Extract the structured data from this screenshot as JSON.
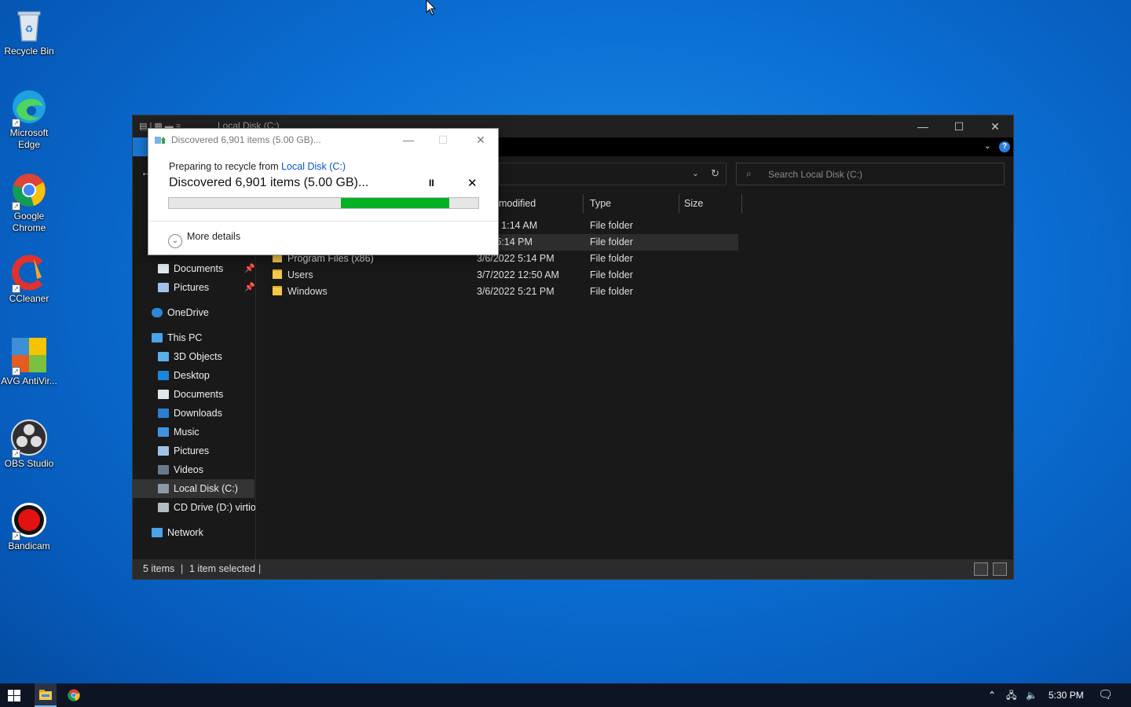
{
  "desktop": {
    "icons": [
      {
        "name": "recycle-bin-icon",
        "label": "Recycle Bin"
      },
      {
        "name": "edge-icon",
        "label": "Microsoft Edge"
      },
      {
        "name": "chrome-icon",
        "label": "Google Chrome"
      },
      {
        "name": "ccleaner-icon",
        "label": "CCleaner"
      },
      {
        "name": "avg-icon",
        "label": "AVG AntiVir..."
      },
      {
        "name": "obs-icon",
        "label": "OBS Studio"
      },
      {
        "name": "bandicam-icon",
        "label": "Bandicam"
      }
    ]
  },
  "explorer": {
    "title": "Local Disk (C:)",
    "search_placeholder": "Search Local Disk (C:)",
    "columns": [
      "modified",
      "Type",
      "Size"
    ],
    "nav": {
      "quick_documents": "Documents",
      "quick_pictures": "Pictures",
      "onedrive": "OneDrive",
      "this_pc": "This PC",
      "objects3d": "3D Objects",
      "desktop": "Desktop",
      "documents": "Documents",
      "downloads": "Downloads",
      "music": "Music",
      "pictures": "Pictures",
      "videos": "Videos",
      "local_disk": "Local Disk (C:)",
      "cd_drive": "CD Drive (D:) virtio-",
      "network": "Network"
    },
    "rows": [
      {
        "name": "",
        "date": "2019 1:14 AM",
        "type": "File folder"
      },
      {
        "name": "",
        "date": "022 5:14 PM",
        "type": "File folder"
      },
      {
        "name": "Program Files (x86)",
        "date": "3/6/2022 5:14 PM",
        "type": "File folder"
      },
      {
        "name": "Users",
        "date": "3/7/2022 12:50 AM",
        "type": "File folder"
      },
      {
        "name": "Windows",
        "date": "3/6/2022 5:21 PM",
        "type": "File folder"
      }
    ],
    "status": {
      "items": "5 items",
      "selected": "1 item selected"
    }
  },
  "dialog": {
    "title": "Discovered 6,901 items (5.00 GB)...",
    "preparing": "Preparing to recycle from ",
    "source_link": "Local Disk (C:)",
    "main_text": "Discovered 6,901 items (5.00 GB)...",
    "pause_symbol": "II",
    "cancel_symbol": "✕",
    "more_details": "More details",
    "progress_fraction": 0.35
  },
  "taskbar": {
    "clock": "5:30 PM"
  },
  "colors": {
    "accent": "#1976d2",
    "progress": "#06b025",
    "link": "#0a55c4"
  }
}
